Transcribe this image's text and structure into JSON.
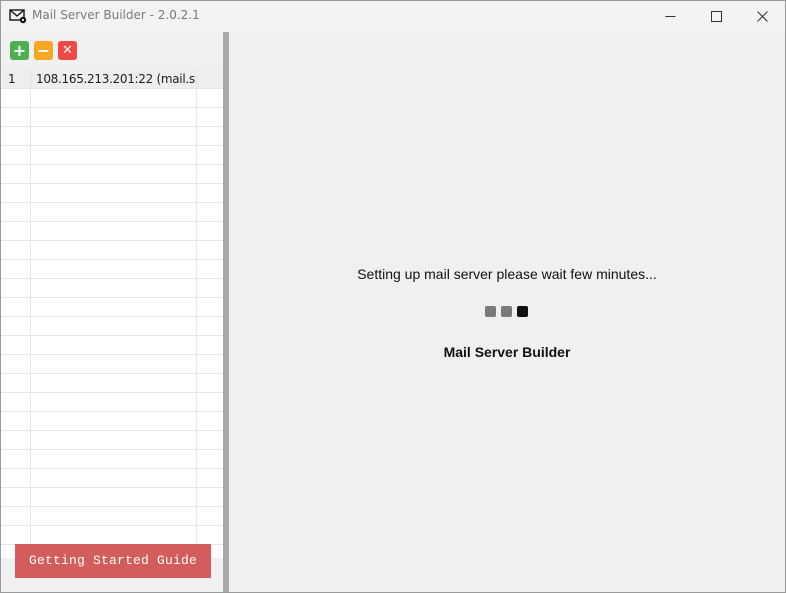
{
  "window": {
    "title": "Mail Server Builder - 2.0.2.1",
    "icon": "envelope-settings-icon",
    "controls": [
      "minimize-icon",
      "maximize-icon",
      "close-icon"
    ]
  },
  "toolbar": {
    "add_label": "+",
    "remove_label": "−",
    "delete_label": "✕",
    "colors": {
      "add": "#4caf50",
      "remove": "#f5a623",
      "delete": "#f04747"
    }
  },
  "server_list": {
    "rows": [
      {
        "index": "1",
        "server": "108.165.213.201:22 (mail.sm..."
      }
    ]
  },
  "guide_button": {
    "label": "Getting Started Guide",
    "color": "#d35c5c"
  },
  "main": {
    "status": "Setting up mail server please wait few minutes...",
    "loading_dots": {
      "colors": [
        "#7a7a7a",
        "#7a7a7a",
        "#111111"
      ]
    },
    "app_name": "Mail Server Builder"
  }
}
